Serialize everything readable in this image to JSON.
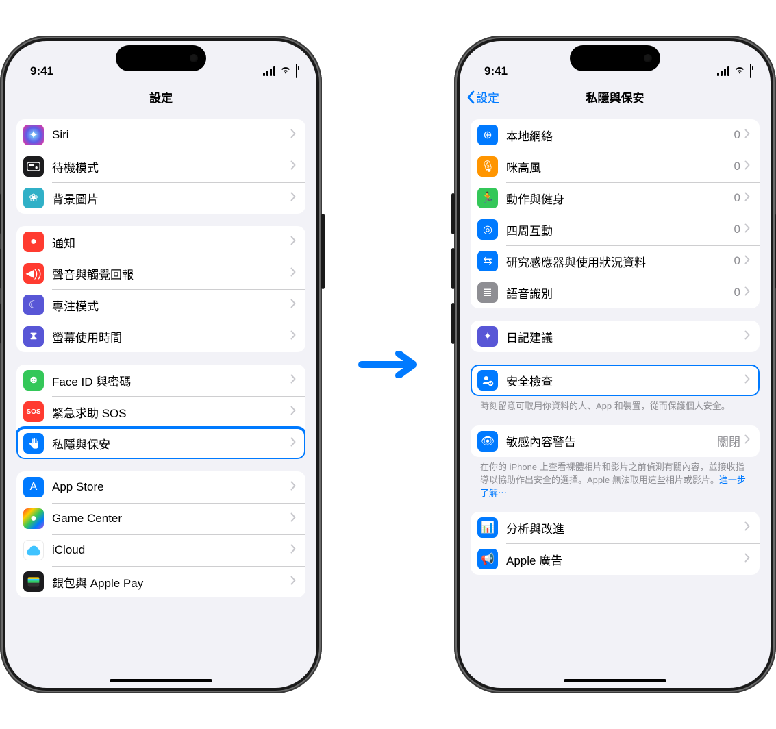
{
  "status": {
    "time": "9:41"
  },
  "phone1": {
    "title": "設定",
    "groups": [
      {
        "rows": [
          {
            "icon": "siri-icon",
            "iconClass": "bg-grad-siri",
            "glyph": "✦",
            "label": "Siri"
          },
          {
            "icon": "standby-icon",
            "iconClass": "bg-black",
            "glyph": "☁︎",
            "label": "待機模式"
          },
          {
            "icon": "wallpaper-icon",
            "iconClass": "bg-teal",
            "glyph": "❀",
            "label": "背景圖片"
          }
        ]
      },
      {
        "rows": [
          {
            "icon": "notifications-icon",
            "iconClass": "bg-red",
            "glyph": "●",
            "label": "通知"
          },
          {
            "icon": "sounds-icon",
            "iconClass": "bg-red",
            "glyph": "◀︎))",
            "label": "聲音與觸覺回報"
          },
          {
            "icon": "focus-icon",
            "iconClass": "bg-purple",
            "glyph": "☾",
            "label": "專注模式"
          },
          {
            "icon": "screentime-icon",
            "iconClass": "bg-purple",
            "glyph": "⧗",
            "label": "螢幕使用時間"
          }
        ]
      },
      {
        "rows": [
          {
            "icon": "faceid-icon",
            "iconClass": "bg-green",
            "glyph": "☻",
            "label": "Face ID 與密碼"
          },
          {
            "icon": "sos-icon",
            "iconClass": "bg-red",
            "glyph": "SOS",
            "label": "緊急求助 SOS"
          },
          {
            "icon": "privacy-icon",
            "iconClass": "bg-blue",
            "glyph": "✋",
            "label": "私隱與保安",
            "highlight": true
          }
        ]
      },
      {
        "rows": [
          {
            "icon": "appstore-icon",
            "iconClass": "bg-blue",
            "glyph": "A",
            "label": "App Store"
          },
          {
            "icon": "gamecenter-icon",
            "iconClass": "bg-grad-gc",
            "glyph": "●",
            "label": "Game Center"
          },
          {
            "icon": "icloud-icon",
            "iconClass": "bg-white-border",
            "glyph": "☁︎",
            "label": "iCloud"
          },
          {
            "icon": "wallet-icon",
            "iconClass": "bg-black",
            "glyph": "▭",
            "label": "銀包與 Apple Pay"
          }
        ]
      }
    ]
  },
  "phone2": {
    "backLabel": "設定",
    "title": "私隱與保安",
    "groups": [
      {
        "rows": [
          {
            "icon": "localnet-icon",
            "iconClass": "bg-blue",
            "glyph": "⊕",
            "label": "本地網絡",
            "value": "0"
          },
          {
            "icon": "mic-icon",
            "iconClass": "bg-orange",
            "glyph": "🎙",
            "label": "咪高風",
            "value": "0"
          },
          {
            "icon": "motion-icon",
            "iconClass": "bg-green",
            "glyph": "🏃",
            "label": "動作與健身",
            "value": "0"
          },
          {
            "icon": "nearby-icon",
            "iconClass": "bg-blue",
            "glyph": "◎",
            "label": "四周互動",
            "value": "0"
          },
          {
            "icon": "research-icon",
            "iconClass": "bg-blue",
            "glyph": "⇆",
            "label": "研究感應器與使用狀況資料",
            "value": "0"
          },
          {
            "icon": "speech-icon",
            "iconClass": "bg-gray",
            "glyph": "≣",
            "label": "語音識別",
            "value": "0"
          }
        ]
      },
      {
        "rows": [
          {
            "icon": "journal-icon",
            "iconClass": "bg-purple",
            "glyph": "✦",
            "label": "日記建議"
          }
        ]
      },
      {
        "rows": [
          {
            "icon": "safety-check-icon",
            "iconClass": "bg-blue",
            "glyph": "☑",
            "label": "安全檢查",
            "highlight": true
          }
        ],
        "footer": "時刻留意可取用你資料的人、App 和裝置，從而保護個人安全。"
      },
      {
        "rows": [
          {
            "icon": "sensitive-content-icon",
            "iconClass": "bg-blue",
            "glyph": "👁",
            "label": "敏感內容警告",
            "value": "關閉"
          }
        ],
        "footer": "在你的 iPhone 上查看裸體相片和影片之前偵測有關內容，並接收指導以協助作出安全的選擇。Apple 無法取用這些相片或影片。",
        "footerLink": "進一步了解⋯"
      },
      {
        "rows": [
          {
            "icon": "analytics-icon",
            "iconClass": "bg-blue",
            "glyph": "📊",
            "label": "分析與改進"
          },
          {
            "icon": "ads-icon",
            "iconClass": "bg-blue",
            "glyph": "📢",
            "label": "Apple 廣告"
          }
        ]
      }
    ]
  }
}
